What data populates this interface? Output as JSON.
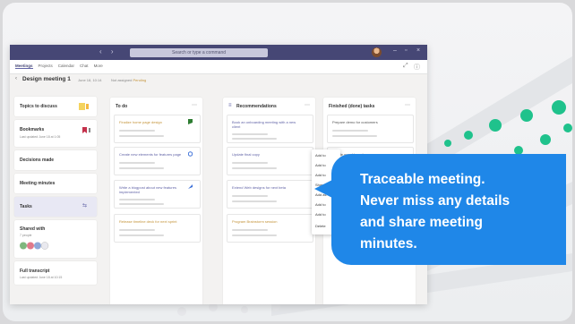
{
  "window": {
    "title_search": "Search or type a command",
    "tabs": [
      "Meetings",
      "Projects",
      "Calendar",
      "Chat",
      "More"
    ],
    "active_tab": 0
  },
  "meeting": {
    "title": "Design meeting 1",
    "date": "June 18, 10:14",
    "status_label": "Not assigned",
    "status_value": "Pending"
  },
  "sidebar": {
    "topics": "Topics to discuss",
    "bookmarks": "Bookmarks",
    "bookmarks_sub": "Last updated June 18 at 1:05",
    "decisions": "Decisions made",
    "minutes": "Meeting minutes",
    "tasks": "Tasks",
    "shared": "Shared with",
    "shared_sub": "7 people",
    "transcript": "Full transcript",
    "transcript_sub": "Last updated June 18 at 10:15"
  },
  "columns": [
    {
      "title": "To do",
      "items": [
        "Finalize home page design",
        "Create new elements for features page",
        "Write a blogpost about new features implemented",
        "Release timeline deck for next sprint"
      ]
    },
    {
      "title": "Recommendations",
      "items": [
        "Book an onboarding meeting with a new client",
        "Update final copy",
        "Extend Web designs for next beta",
        "Program Brainstorm session"
      ]
    },
    {
      "title": "Finished (done) tasks",
      "items": [
        "Prepare demo for customers",
        "Create mood board"
      ]
    }
  ],
  "context_menu": [
    "Add to",
    "Add to",
    "Add to",
    "Share",
    "Add as",
    "Add to",
    "Add to",
    "Delete"
  ],
  "callout": {
    "lines": [
      "Traceable meeting.",
      "Never miss any details",
      "and share meeting",
      "minutes."
    ]
  },
  "colors": {
    "accent": "#6264a7",
    "callout": "#1f87e8",
    "titlebar": "#464775"
  }
}
